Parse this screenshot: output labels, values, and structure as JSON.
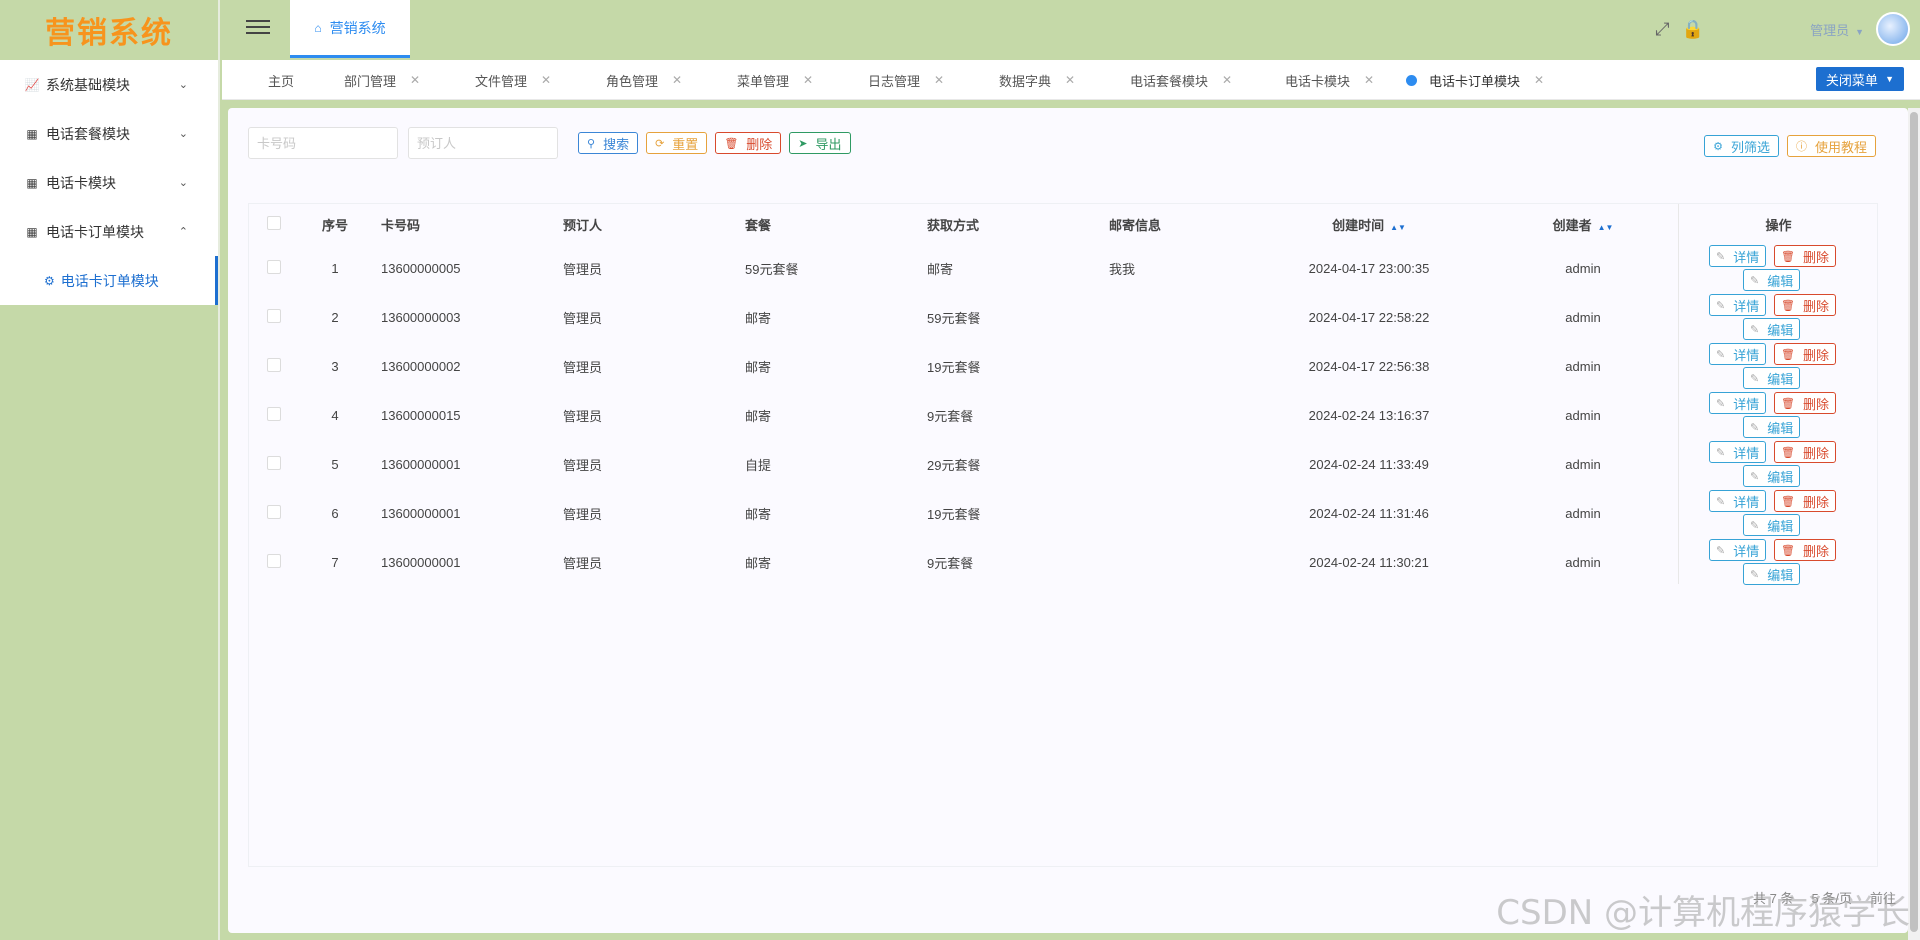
{
  "app": {
    "logo_text": "营销系统",
    "home_tab": "营销系统",
    "user_label": "管理员"
  },
  "sidebar": {
    "items": [
      {
        "label": "系统基础模块",
        "icon": "chart-icon",
        "expanded": false
      },
      {
        "label": "电话套餐模块",
        "icon": "grid-icon",
        "expanded": false
      },
      {
        "label": "电话卡模块",
        "icon": "grid-icon",
        "expanded": false
      },
      {
        "label": "电话卡订单模块",
        "icon": "grid-icon",
        "expanded": true
      }
    ],
    "sub_item": "电话卡订单模块"
  },
  "tags": [
    {
      "label": "主页",
      "closable": false
    },
    {
      "label": "部门管理",
      "closable": true
    },
    {
      "label": "文件管理",
      "closable": true
    },
    {
      "label": "角色管理",
      "closable": true
    },
    {
      "label": "菜单管理",
      "closable": true
    },
    {
      "label": "日志管理",
      "closable": true
    },
    {
      "label": "数据字典",
      "closable": true
    },
    {
      "label": "电话套餐模块",
      "closable": true
    },
    {
      "label": "电话卡模块",
      "closable": true
    },
    {
      "label": "电话卡订单模块",
      "closable": true,
      "active": true
    }
  ],
  "close_menu_label": "关闭菜单",
  "search": {
    "card_placeholder": "卡号码",
    "orderer_placeholder": "预订人",
    "search_label": "搜索",
    "reset_label": "重置",
    "delete_label": "删除",
    "export_label": "导出",
    "column_filter_label": "列筛选",
    "tutorial_label": "使用教程"
  },
  "table": {
    "headers": {
      "index": "序号",
      "card": "卡号码",
      "orderer": "预订人",
      "package": "套餐",
      "method": "获取方式",
      "mail": "邮寄信息",
      "created_time": "创建时间",
      "creator": "创建者",
      "ops": "操作"
    },
    "rows": [
      {
        "index": "1",
        "card": "13600000005",
        "orderer": "管理员",
        "package": "59元套餐",
        "method": "邮寄",
        "mail": "我我",
        "created_time": "2024-04-17 23:00:35",
        "creator": "admin"
      },
      {
        "index": "2",
        "card": "13600000003",
        "orderer": "管理员",
        "package": "邮寄",
        "method": "59元套餐",
        "mail": "",
        "created_time": "2024-04-17 22:58:22",
        "creator": "admin"
      },
      {
        "index": "3",
        "card": "13600000002",
        "orderer": "管理员",
        "package": "邮寄",
        "method": "19元套餐",
        "mail": "",
        "created_time": "2024-04-17 22:56:38",
        "creator": "admin"
      },
      {
        "index": "4",
        "card": "13600000015",
        "orderer": "管理员",
        "package": "邮寄",
        "method": "9元套餐",
        "mail": "",
        "created_time": "2024-02-24 13:16:37",
        "creator": "admin"
      },
      {
        "index": "5",
        "card": "13600000001",
        "orderer": "管理员",
        "package": "自提",
        "method": "29元套餐",
        "mail": "",
        "created_time": "2024-02-24 11:33:49",
        "creator": "admin"
      },
      {
        "index": "6",
        "card": "13600000001",
        "orderer": "管理员",
        "package": "邮寄",
        "method": "19元套餐",
        "mail": "",
        "created_time": "2024-02-24 11:31:46",
        "creator": "admin"
      },
      {
        "index": "7",
        "card": "13600000001",
        "orderer": "管理员",
        "package": "邮寄",
        "method": "9元套餐",
        "mail": "",
        "created_time": "2024-02-24 11:30:21",
        "creator": "admin"
      }
    ],
    "op_labels": {
      "detail": "详情",
      "delete": "删除",
      "edit": "编辑"
    }
  },
  "pagination": {
    "total": "共 7 条",
    "page_size": "5 条/页",
    "goto": "前往"
  },
  "watermark": "CSDN @计算机程序猿学长",
  "colors": {
    "sidebar_bg": "#c5d9a8",
    "accent": "#1d6fd0",
    "logo": "#f7941d",
    "danger": "#d84a2d",
    "warning": "#e6a23c",
    "success": "#2f9a63"
  }
}
